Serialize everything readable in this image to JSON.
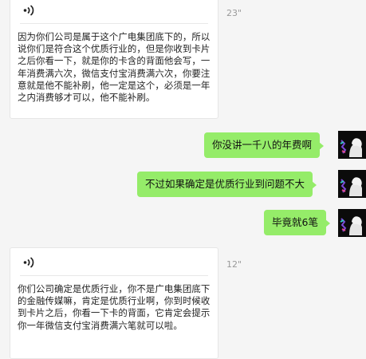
{
  "messages": [
    {
      "side": "left",
      "type": "voice",
      "duration": "23\"",
      "transcript": "因为你们公司是属于这个广电集团底下的，所以说你们是符合这个优质行业的，但是你收到卡片之后你看一下，就是你的卡含的背面他会写，一年消费满六次，微信支付宝消费满六次，你要注意就是他不能补刷，他一定是这个，必须是一年之内消费够才可以，他不能补刷。"
    },
    {
      "side": "right",
      "type": "text",
      "text": "你没讲一千八的年费啊"
    },
    {
      "side": "right",
      "type": "text",
      "text": "不过如果确定是优质行业到问题不大"
    },
    {
      "side": "right",
      "type": "text",
      "text": "毕竟就6笔"
    },
    {
      "side": "left",
      "type": "voice",
      "duration": "12\"",
      "transcript": "你们公司确定是优质行业，你不是广电集团底下的金融传媒嘛，肯定是优质行业啊，你到时候收到卡片之后，你看一下卡的背面，它肯定会提示你一年微信支付宝消费满六笔就可以啦。"
    }
  ],
  "icons": {
    "voice": "voice-wave-icon",
    "avatar": "user-avatar"
  },
  "colors": {
    "background": "#f5f5f5",
    "bubble_left": "#ffffff",
    "bubble_right": "#95ec69",
    "duration_text": "#9a9a9a"
  }
}
